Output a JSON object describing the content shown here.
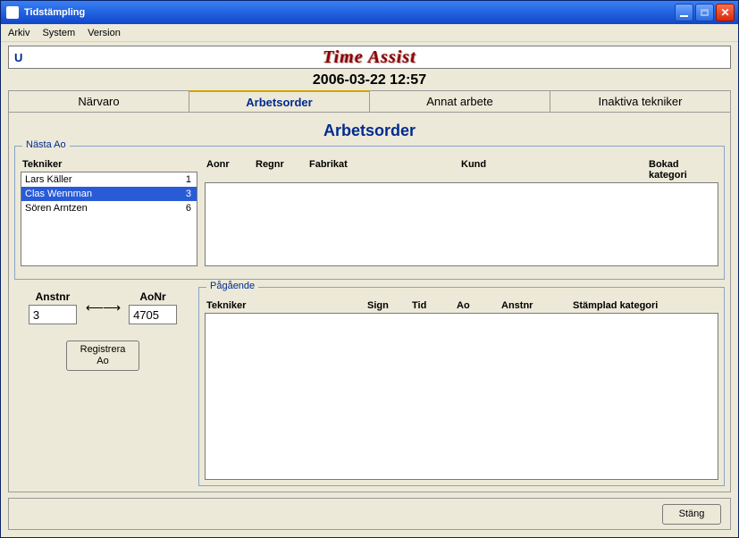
{
  "window": {
    "title": "Tidstämpling"
  },
  "menubar": {
    "items": [
      "Arkiv",
      "System",
      "Version"
    ]
  },
  "banner": {
    "left": "U",
    "app_title": "Time Assist"
  },
  "datetime": "2006-03-22 12:57",
  "tabs": {
    "items": [
      "Närvaro",
      "Arbetsorder",
      "Annat arbete",
      "Inaktiva tekniker"
    ],
    "active_index": 1
  },
  "page_heading": "Arbetsorder",
  "nasta_ao": {
    "legend": "Nästa Ao",
    "tekniker_header": "Tekniker",
    "tekniker": [
      {
        "name": "Lars Käller",
        "num": "1",
        "selected": false
      },
      {
        "name": "Clas Wennman",
        "num": "3",
        "selected": true
      },
      {
        "name": "Sören Arntzen",
        "num": "6",
        "selected": false
      }
    ],
    "detail_headers": {
      "aonr": "Aonr",
      "regnr": "Regnr",
      "fabrikat": "Fabrikat",
      "kund": "Kund",
      "bokad": "Bokad kategori"
    }
  },
  "inputs": {
    "anstnr_label": "Anstnr",
    "anstnr_value": "3",
    "aonr_label": "AoNr",
    "aonr_value": "4705",
    "arrow": "⟵⟶",
    "register_label": "Registrera\nAo"
  },
  "pagaende": {
    "legend": "Pågående",
    "headers": {
      "tekniker": "Tekniker",
      "sign": "Sign",
      "tid": "Tid",
      "ao": "Ao",
      "anstnr": "Anstnr",
      "stamplad": "Stämplad kategori"
    }
  },
  "footer": {
    "close_label": "Stäng"
  }
}
